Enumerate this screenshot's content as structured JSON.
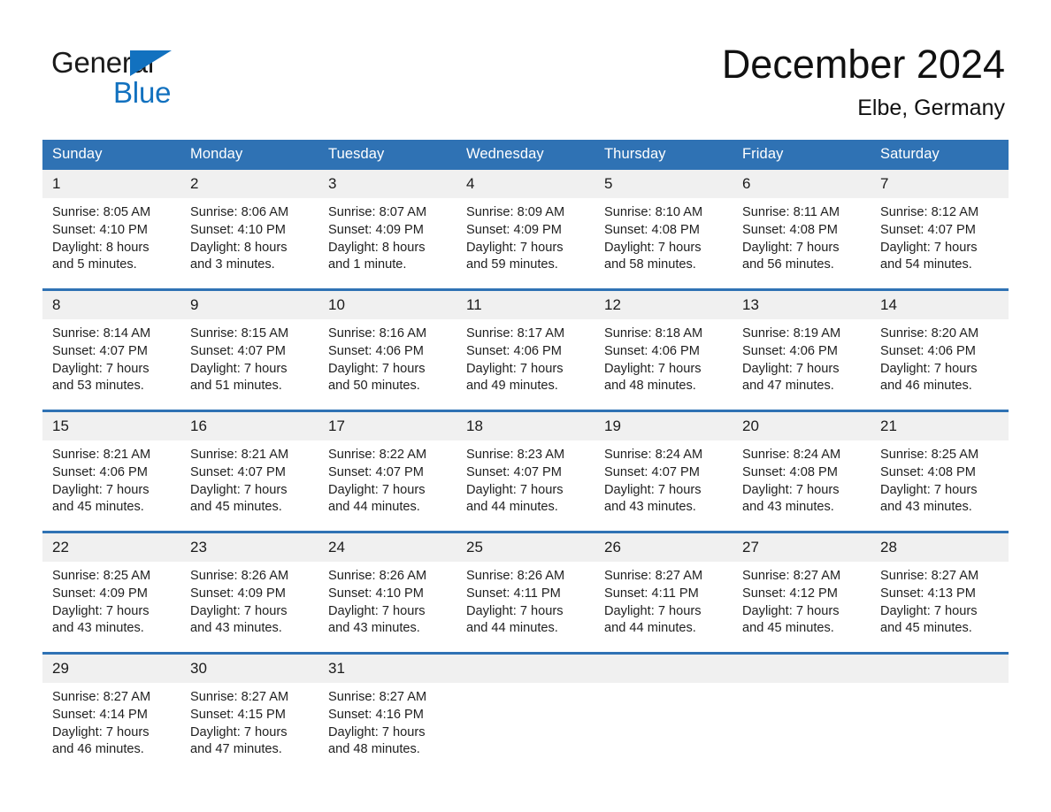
{
  "brand": {
    "name_line1": "General",
    "name_line2": "Blue",
    "flag_icon": "triangle-flag-icon",
    "accent_color": "#1271bf"
  },
  "header": {
    "month_title": "December 2024",
    "location": "Elbe, Germany"
  },
  "theme": {
    "header_row_color": "#2f72b4",
    "daynum_band_color": "#f0f0f0",
    "row_divider_color": "#2f72b4",
    "text_color": "#1b1b1b"
  },
  "calendar": {
    "weekday_headers": [
      "Sunday",
      "Monday",
      "Tuesday",
      "Wednesday",
      "Thursday",
      "Friday",
      "Saturday"
    ],
    "weeks": [
      [
        {
          "day": "1",
          "sunrise": "Sunrise: 8:05 AM",
          "sunset": "Sunset: 4:10 PM",
          "daylight_line1": "Daylight: 8 hours",
          "daylight_line2": "and 5 minutes."
        },
        {
          "day": "2",
          "sunrise": "Sunrise: 8:06 AM",
          "sunset": "Sunset: 4:10 PM",
          "daylight_line1": "Daylight: 8 hours",
          "daylight_line2": "and 3 minutes."
        },
        {
          "day": "3",
          "sunrise": "Sunrise: 8:07 AM",
          "sunset": "Sunset: 4:09 PM",
          "daylight_line1": "Daylight: 8 hours",
          "daylight_line2": "and 1 minute."
        },
        {
          "day": "4",
          "sunrise": "Sunrise: 8:09 AM",
          "sunset": "Sunset: 4:09 PM",
          "daylight_line1": "Daylight: 7 hours",
          "daylight_line2": "and 59 minutes."
        },
        {
          "day": "5",
          "sunrise": "Sunrise: 8:10 AM",
          "sunset": "Sunset: 4:08 PM",
          "daylight_line1": "Daylight: 7 hours",
          "daylight_line2": "and 58 minutes."
        },
        {
          "day": "6",
          "sunrise": "Sunrise: 8:11 AM",
          "sunset": "Sunset: 4:08 PM",
          "daylight_line1": "Daylight: 7 hours",
          "daylight_line2": "and 56 minutes."
        },
        {
          "day": "7",
          "sunrise": "Sunrise: 8:12 AM",
          "sunset": "Sunset: 4:07 PM",
          "daylight_line1": "Daylight: 7 hours",
          "daylight_line2": "and 54 minutes."
        }
      ],
      [
        {
          "day": "8",
          "sunrise": "Sunrise: 8:14 AM",
          "sunset": "Sunset: 4:07 PM",
          "daylight_line1": "Daylight: 7 hours",
          "daylight_line2": "and 53 minutes."
        },
        {
          "day": "9",
          "sunrise": "Sunrise: 8:15 AM",
          "sunset": "Sunset: 4:07 PM",
          "daylight_line1": "Daylight: 7 hours",
          "daylight_line2": "and 51 minutes."
        },
        {
          "day": "10",
          "sunrise": "Sunrise: 8:16 AM",
          "sunset": "Sunset: 4:06 PM",
          "daylight_line1": "Daylight: 7 hours",
          "daylight_line2": "and 50 minutes."
        },
        {
          "day": "11",
          "sunrise": "Sunrise: 8:17 AM",
          "sunset": "Sunset: 4:06 PM",
          "daylight_line1": "Daylight: 7 hours",
          "daylight_line2": "and 49 minutes."
        },
        {
          "day": "12",
          "sunrise": "Sunrise: 8:18 AM",
          "sunset": "Sunset: 4:06 PM",
          "daylight_line1": "Daylight: 7 hours",
          "daylight_line2": "and 48 minutes."
        },
        {
          "day": "13",
          "sunrise": "Sunrise: 8:19 AM",
          "sunset": "Sunset: 4:06 PM",
          "daylight_line1": "Daylight: 7 hours",
          "daylight_line2": "and 47 minutes."
        },
        {
          "day": "14",
          "sunrise": "Sunrise: 8:20 AM",
          "sunset": "Sunset: 4:06 PM",
          "daylight_line1": "Daylight: 7 hours",
          "daylight_line2": "and 46 minutes."
        }
      ],
      [
        {
          "day": "15",
          "sunrise": "Sunrise: 8:21 AM",
          "sunset": "Sunset: 4:06 PM",
          "daylight_line1": "Daylight: 7 hours",
          "daylight_line2": "and 45 minutes."
        },
        {
          "day": "16",
          "sunrise": "Sunrise: 8:21 AM",
          "sunset": "Sunset: 4:07 PM",
          "daylight_line1": "Daylight: 7 hours",
          "daylight_line2": "and 45 minutes."
        },
        {
          "day": "17",
          "sunrise": "Sunrise: 8:22 AM",
          "sunset": "Sunset: 4:07 PM",
          "daylight_line1": "Daylight: 7 hours",
          "daylight_line2": "and 44 minutes."
        },
        {
          "day": "18",
          "sunrise": "Sunrise: 8:23 AM",
          "sunset": "Sunset: 4:07 PM",
          "daylight_line1": "Daylight: 7 hours",
          "daylight_line2": "and 44 minutes."
        },
        {
          "day": "19",
          "sunrise": "Sunrise: 8:24 AM",
          "sunset": "Sunset: 4:07 PM",
          "daylight_line1": "Daylight: 7 hours",
          "daylight_line2": "and 43 minutes."
        },
        {
          "day": "20",
          "sunrise": "Sunrise: 8:24 AM",
          "sunset": "Sunset: 4:08 PM",
          "daylight_line1": "Daylight: 7 hours",
          "daylight_line2": "and 43 minutes."
        },
        {
          "day": "21",
          "sunrise": "Sunrise: 8:25 AM",
          "sunset": "Sunset: 4:08 PM",
          "daylight_line1": "Daylight: 7 hours",
          "daylight_line2": "and 43 minutes."
        }
      ],
      [
        {
          "day": "22",
          "sunrise": "Sunrise: 8:25 AM",
          "sunset": "Sunset: 4:09 PM",
          "daylight_line1": "Daylight: 7 hours",
          "daylight_line2": "and 43 minutes."
        },
        {
          "day": "23",
          "sunrise": "Sunrise: 8:26 AM",
          "sunset": "Sunset: 4:09 PM",
          "daylight_line1": "Daylight: 7 hours",
          "daylight_line2": "and 43 minutes."
        },
        {
          "day": "24",
          "sunrise": "Sunrise: 8:26 AM",
          "sunset": "Sunset: 4:10 PM",
          "daylight_line1": "Daylight: 7 hours",
          "daylight_line2": "and 43 minutes."
        },
        {
          "day": "25",
          "sunrise": "Sunrise: 8:26 AM",
          "sunset": "Sunset: 4:11 PM",
          "daylight_line1": "Daylight: 7 hours",
          "daylight_line2": "and 44 minutes."
        },
        {
          "day": "26",
          "sunrise": "Sunrise: 8:27 AM",
          "sunset": "Sunset: 4:11 PM",
          "daylight_line1": "Daylight: 7 hours",
          "daylight_line2": "and 44 minutes."
        },
        {
          "day": "27",
          "sunrise": "Sunrise: 8:27 AM",
          "sunset": "Sunset: 4:12 PM",
          "daylight_line1": "Daylight: 7 hours",
          "daylight_line2": "and 45 minutes."
        },
        {
          "day": "28",
          "sunrise": "Sunrise: 8:27 AM",
          "sunset": "Sunset: 4:13 PM",
          "daylight_line1": "Daylight: 7 hours",
          "daylight_line2": "and 45 minutes."
        }
      ],
      [
        {
          "day": "29",
          "sunrise": "Sunrise: 8:27 AM",
          "sunset": "Sunset: 4:14 PM",
          "daylight_line1": "Daylight: 7 hours",
          "daylight_line2": "and 46 minutes."
        },
        {
          "day": "30",
          "sunrise": "Sunrise: 8:27 AM",
          "sunset": "Sunset: 4:15 PM",
          "daylight_line1": "Daylight: 7 hours",
          "daylight_line2": "and 47 minutes."
        },
        {
          "day": "31",
          "sunrise": "Sunrise: 8:27 AM",
          "sunset": "Sunset: 4:16 PM",
          "daylight_line1": "Daylight: 7 hours",
          "daylight_line2": "and 48 minutes."
        },
        {
          "day": "",
          "sunrise": "",
          "sunset": "",
          "daylight_line1": "",
          "daylight_line2": ""
        },
        {
          "day": "",
          "sunrise": "",
          "sunset": "",
          "daylight_line1": "",
          "daylight_line2": ""
        },
        {
          "day": "",
          "sunrise": "",
          "sunset": "",
          "daylight_line1": "",
          "daylight_line2": ""
        },
        {
          "day": "",
          "sunrise": "",
          "sunset": "",
          "daylight_line1": "",
          "daylight_line2": ""
        }
      ]
    ]
  }
}
